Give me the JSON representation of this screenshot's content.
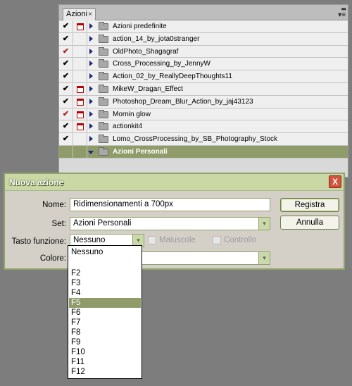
{
  "panel": {
    "tab_label": "Azioni",
    "tab_close": "×",
    "collapse_glyph": "◂◂",
    "menu_glyph": "▾≡",
    "rows": [
      {
        "check": "✔",
        "check_color": "black",
        "dialog": true,
        "label": "Azioni predefinite",
        "open": false,
        "selected": false
      },
      {
        "check": "✔",
        "check_color": "black",
        "dialog": false,
        "label": "action_14_by_jota0stranger",
        "open": false,
        "selected": false
      },
      {
        "check": "✔",
        "check_color": "red",
        "dialog": false,
        "label": "OldPhoto_Shagagraf",
        "open": false,
        "selected": false
      },
      {
        "check": "✔",
        "check_color": "black",
        "dialog": false,
        "label": "Cross_Processing_by_JennyW",
        "open": false,
        "selected": false
      },
      {
        "check": "✔",
        "check_color": "black",
        "dialog": false,
        "label": "Action_02_by_ReallyDeepThoughts11",
        "open": false,
        "selected": false
      },
      {
        "check": "✔",
        "check_color": "black",
        "dialog": true,
        "label": "MikeW_Dragan_Effect",
        "open": false,
        "selected": false
      },
      {
        "check": "✔",
        "check_color": "black",
        "dialog": true,
        "label": "Photoshop_Dream_Blur_Action_by_jaj43123",
        "open": false,
        "selected": false
      },
      {
        "check": "✔",
        "check_color": "red",
        "dialog": true,
        "label": "Mornin glow",
        "open": false,
        "selected": false
      },
      {
        "check": "✔",
        "check_color": "black",
        "dialog": true,
        "label": "actionkit4",
        "open": false,
        "selected": false
      },
      {
        "check": "✔",
        "check_color": "black",
        "dialog": false,
        "label": "Lomo_CrossProcessing_by_SB_Photography_Stock",
        "open": false,
        "selected": false
      },
      {
        "check": "",
        "check_color": "black",
        "dialog": false,
        "label": "Azioni Personali",
        "open": true,
        "selected": true
      }
    ]
  },
  "dialog": {
    "title": "Nuova azione",
    "close_glyph": "X",
    "name_label": "Nome:",
    "name_value": "Ridimensionamenti a 700px",
    "set_label": "Set:",
    "set_value": "Azioni Personali",
    "fkey_label": "Tasto funzione:",
    "fkey_value": "Nessuno",
    "shift_label": "Maiuscole",
    "ctrl_label": "Controllo",
    "color_label": "Colore:",
    "record_button": "Registra",
    "cancel_button": "Annulla",
    "dropdown_glyph": "▾"
  },
  "fkey_options": {
    "items": [
      "Nessuno",
      "",
      "F2",
      "F3",
      "F4",
      "F5",
      "F6",
      "F7",
      "F8",
      "F9",
      "F10",
      "F11",
      "F12"
    ],
    "highlighted": "F5"
  }
}
